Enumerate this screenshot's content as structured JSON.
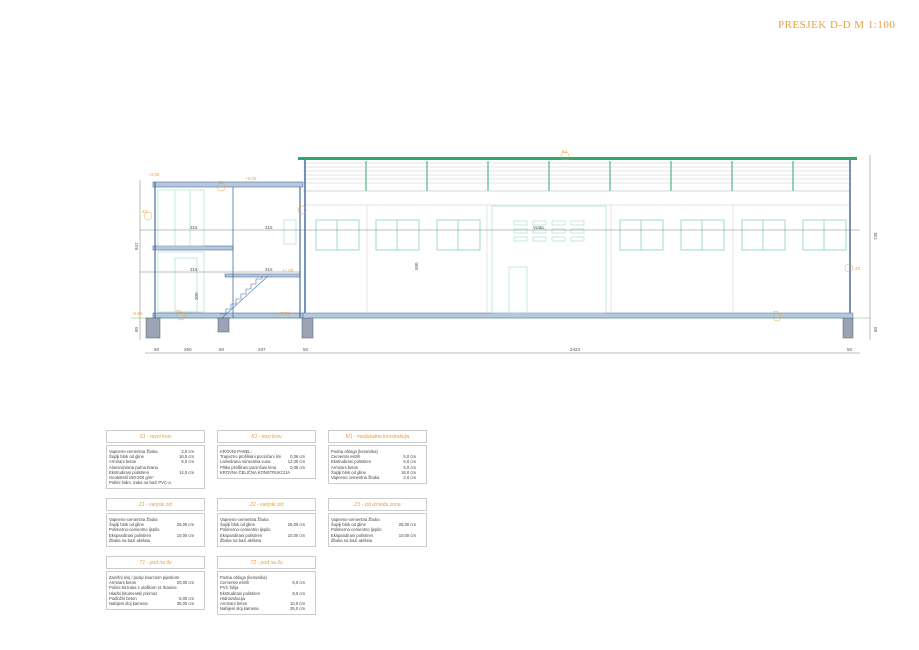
{
  "title": "PRESJEK D-D M 1:100",
  "colors": {
    "accent": "#e8a040",
    "roof": "#2fa86a",
    "structure": "#4a6fa0",
    "glazing": "#9fd8cf"
  },
  "drawing": {
    "horizontal_dims": [
      "50",
      "250",
      "50",
      "337",
      "50",
      "2423",
      "50"
    ],
    "vertical_dims": {
      "left_total": "847",
      "right_total": "736",
      "foundation_left": "80",
      "foundation_right": "60"
    },
    "inner_dims": [
      "315",
      "315",
      "500",
      "300",
      "315",
      "315"
    ],
    "level_marks": [
      "+3.00",
      "+3.00",
      "±0.00",
      "+1.00",
      "-0.50"
    ],
    "door_label": "Vrata",
    "tags": [
      "S1",
      "K1",
      "Z1",
      "Z2",
      "T1",
      "T2"
    ]
  },
  "tables": [
    {
      "title": "S1 - ravni krov",
      "rows": [
        [
          "Vapneno-cementna žbuka",
          "2,0 cm"
        ],
        [
          "Šuplji blok od gline",
          "16,0 cm"
        ],
        [
          "Armirani beton",
          "5,0 cm"
        ],
        [
          "Aluminizirana parna brana",
          ""
        ],
        [
          "Ekstrudirani polistiren",
          "14,0 cm"
        ],
        [
          "Geotekstil 150-200 g/m²",
          ""
        ],
        [
          "Polimi hidro. traka na bazi PVC-a",
          ""
        ]
      ]
    },
    {
      "title": "K1 - kosi krov",
      "rows": [
        [
          "KROVNI PANEL:",
          ""
        ],
        [
          "Trapezno profilirani pocinčani lim",
          "0,06 cm"
        ],
        [
          "Lamelirana mineralna vuna",
          "12,00 cm"
        ],
        [
          "Plitko profilirani pocinčani lima",
          "0,06 cm"
        ],
        [
          "",
          ""
        ],
        [
          "KROVNA ČELIČNA KONSTRUKCIJA",
          ""
        ]
      ]
    },
    {
      "title": "M1 - međukatna konstrukcija",
      "rows": [
        [
          "Podna obloga (keramika)",
          ""
        ],
        [
          "Cementni estrih",
          "5,0 cm"
        ],
        [
          "Ekstrudirani polistiren",
          "5,0 cm"
        ],
        [
          "Armirani beton",
          "5,0 cm"
        ],
        [
          "Šuplji blok od gline",
          "16,0 cm"
        ],
        [
          "Vapneno cementna žbuka",
          "2,0 cm"
        ]
      ]
    },
    {
      "title": "Z1 - vanjski zid",
      "rows": [
        [
          "Vapneno-cementna žbuka",
          ""
        ],
        [
          "Šuplji blok od gline",
          "25,00 cm"
        ],
        [
          "Polimerno-cementno ljepilo",
          ""
        ],
        [
          "Ekspandirani polistiren",
          "10,00 cm"
        ],
        [
          "Žbuka na bazi akrilata",
          ""
        ]
      ]
    },
    {
      "title": "Z2 - vanjski zid",
      "rows": [
        [
          "Vapneno-cementna žbuka",
          ""
        ],
        [
          "Šuplji blok od gline",
          "25,00 cm"
        ],
        [
          "Polimerno-cementno ljepilo",
          ""
        ],
        [
          "Ekspandirani polistiren",
          "10,00 cm"
        ],
        [
          "Žbuka na bazi akrilata",
          ""
        ]
      ]
    },
    {
      "title": "Z3 - zid između zona",
      "rows": [
        [
          "Vapneno-cementna žbuka",
          ""
        ],
        [
          "Šuplji blok od gline",
          "25,00 cm"
        ],
        [
          "Polimerno-cementno ljepilo",
          ""
        ],
        [
          "Ekspandirani polistiren",
          "10,00 cm"
        ],
        [
          "Žbuka na bazi akrilata",
          ""
        ]
      ]
    },
    {
      "title": "T1 - pod na tlu",
      "rows": [
        [
          "Završni sloj / posip kvarcnim pijeskom",
          ""
        ],
        [
          "Armirani beton",
          "20,00 cm"
        ],
        [
          "Polimi bit.traka s uloškom st. tkanine",
          ""
        ],
        [
          "Hladni bitumenski premaz",
          ""
        ],
        [
          "Podložni beton",
          "5,00 cm"
        ],
        [
          "Nabijeni sloj kamena",
          "35,00 cm"
        ]
      ]
    },
    {
      "title": "T2 - pod na tlu",
      "rows": [
        [
          "Podna obloga (keramika)",
          ""
        ],
        [
          "Cementni estrih",
          "5,0 cm"
        ],
        [
          "PVC folija",
          ""
        ],
        [
          "Ekstrudirani polistiren",
          "8,0 cm"
        ],
        [
          "Hidroizolacija",
          ""
        ],
        [
          "Armirani beton",
          "10,0 cm"
        ],
        [
          "Nabijeni sloj kamena",
          "35,0 cm"
        ]
      ]
    }
  ]
}
